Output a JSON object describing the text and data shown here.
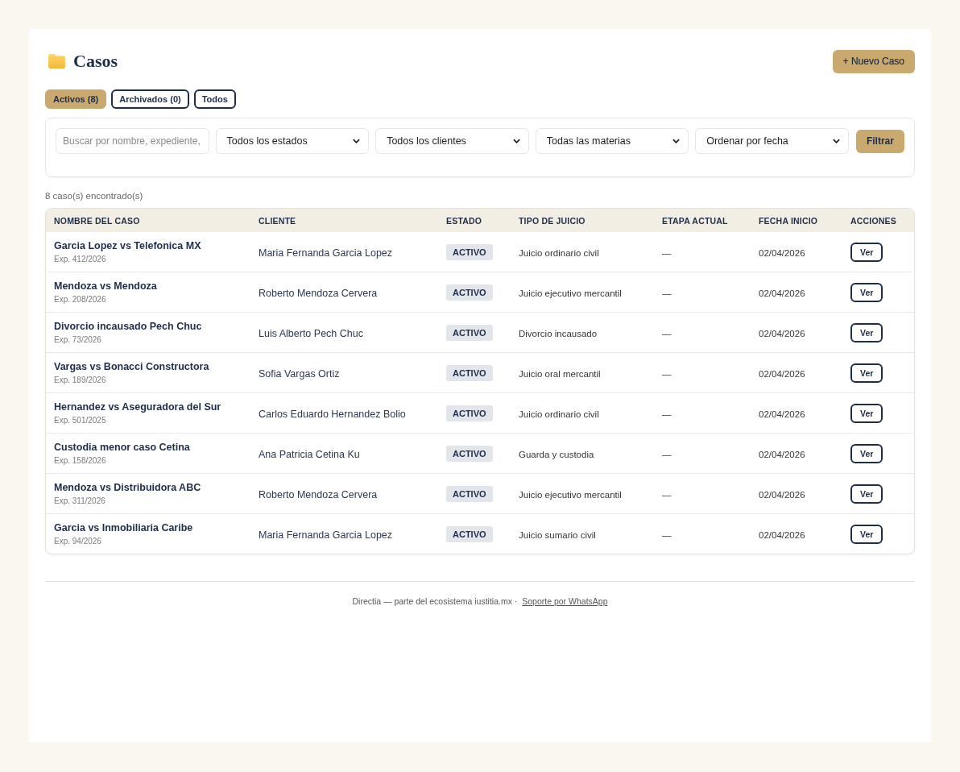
{
  "header": {
    "title": "Casos",
    "new_button": "+ Nuevo Caso"
  },
  "tabs": [
    {
      "label": "Activos (8)",
      "selected": true
    },
    {
      "label": "Archivados (0)",
      "selected": false
    },
    {
      "label": "Todos",
      "selected": false
    }
  ],
  "filters": {
    "search": {
      "placeholder": "Buscar por nombre, expediente,"
    },
    "selects": [
      "Todos los estados",
      "Todos los clientes",
      "Todas las materias",
      "Ordenar por fecha"
    ],
    "button": "Filtrar"
  },
  "result_count": "8 caso(s) encontrado(s)",
  "table": {
    "columns": [
      "NOMBRE DEL CASO",
      "CLIENTE",
      "ESTADO",
      "TIPO DE JUICIO",
      "ETAPA ACTUAL",
      "FECHA INICIO",
      "ACCIONES"
    ],
    "rows": [
      {
        "name": "Garcia Lopez vs Telefonica MX",
        "expediente": "Exp. 412/2026",
        "client": "Maria Fernanda Garcia Lopez",
        "status": "ACTIVO",
        "trial_type": "Juicio ordinario civil",
        "stage": "—",
        "start_date": "02/04/2026",
        "action": "Ver"
      },
      {
        "name": "Mendoza vs Mendoza",
        "expediente": "Exp. 208/2026",
        "client": "Roberto Mendoza Cervera",
        "status": "ACTIVO",
        "trial_type": "Juicio ejecutivo mercantil",
        "stage": "—",
        "start_date": "02/04/2026",
        "action": "Ver"
      },
      {
        "name": "Divorcio incausado Pech Chuc",
        "expediente": "Exp. 73/2026",
        "client": "Luis Alberto Pech Chuc",
        "status": "ACTIVO",
        "trial_type": "Divorcio incausado",
        "stage": "—",
        "start_date": "02/04/2026",
        "action": "Ver"
      },
      {
        "name": "Vargas vs Bonacci Constructora",
        "expediente": "Exp. 189/2026",
        "client": "Sofia Vargas Ortiz",
        "status": "ACTIVO",
        "trial_type": "Juicio oral mercantil",
        "stage": "—",
        "start_date": "02/04/2026",
        "action": "Ver"
      },
      {
        "name": "Hernandez vs Aseguradora del Sur",
        "expediente": "Exp. 501/2025",
        "client": "Carlos Eduardo Hernandez Bolio",
        "status": "ACTIVO",
        "trial_type": "Juicio ordinario civil",
        "stage": "—",
        "start_date": "02/04/2026",
        "action": "Ver"
      },
      {
        "name": "Custodia menor caso Cetina",
        "expediente": "Exp. 158/2026",
        "client": "Ana Patricia Cetina Ku",
        "status": "ACTIVO",
        "trial_type": "Guarda y custodia",
        "stage": "—",
        "start_date": "02/04/2026",
        "action": "Ver"
      },
      {
        "name": "Mendoza vs Distribuidora ABC",
        "expediente": "Exp. 311/2026",
        "client": "Roberto Mendoza Cervera",
        "status": "ACTIVO",
        "trial_type": "Juicio ejecutivo mercantil",
        "stage": "—",
        "start_date": "02/04/2026",
        "action": "Ver"
      },
      {
        "name": "Garcia vs Inmobiliaria Caribe",
        "expediente": "Exp. 94/2026",
        "client": "Maria Fernanda Garcia Lopez",
        "status": "ACTIVO",
        "trial_type": "Juicio sumario civil",
        "stage": "—",
        "start_date": "02/04/2026",
        "action": "Ver"
      }
    ]
  },
  "footer": {
    "text": "Directia — parte del ecosistema iustitia.mx ·",
    "link": "Soporte por WhatsApp"
  }
}
